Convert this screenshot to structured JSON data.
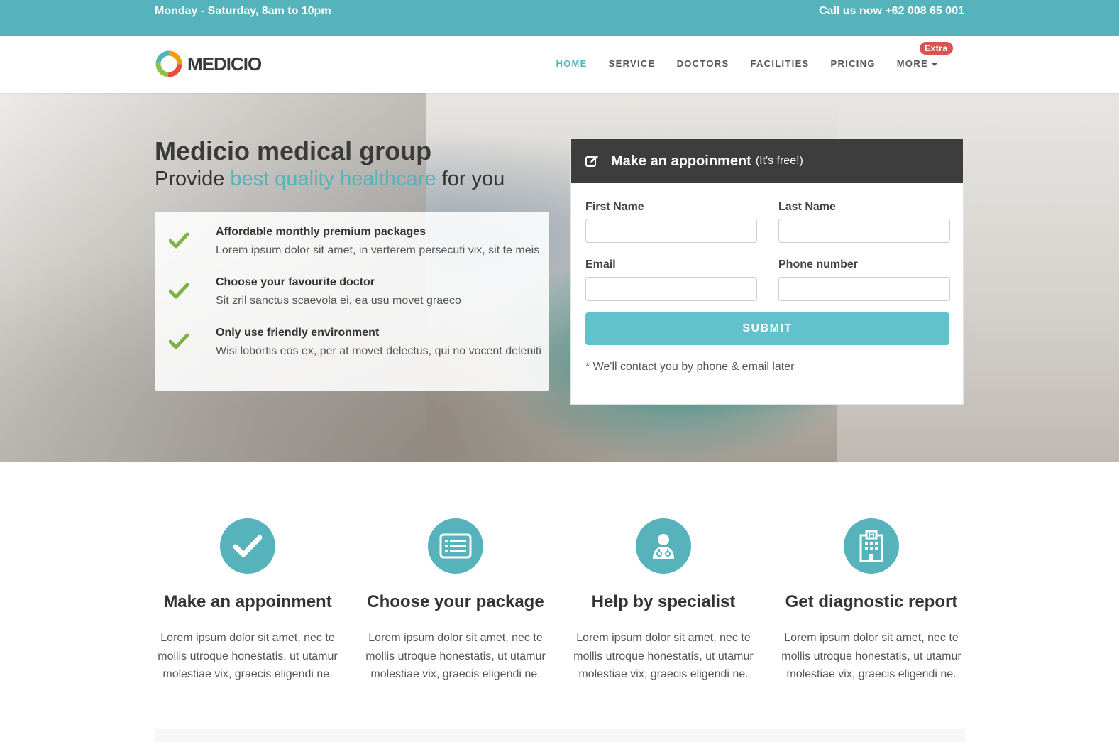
{
  "topbar": {
    "hours": "Monday - Saturday, 8am to 10pm",
    "call": "Call us now +62 008 65 001"
  },
  "brand": {
    "name": "MEDICIO"
  },
  "nav": {
    "items": [
      {
        "label": "HOME",
        "active": true
      },
      {
        "label": "SERVICE"
      },
      {
        "label": "DOCTORS"
      },
      {
        "label": "FACILITIES"
      },
      {
        "label": "PRICING"
      },
      {
        "label": "MORE"
      }
    ],
    "extra_badge": "Extra"
  },
  "hero": {
    "title": "Medicio medical group",
    "sub_prefix": "Provide ",
    "sub_highlight": "best quality healthcare",
    "sub_suffix": " for you",
    "features": [
      {
        "title": "Affordable monthly premium packages",
        "desc": "Lorem ipsum dolor sit amet, in verterem persecuti vix, sit te meis"
      },
      {
        "title": "Choose your favourite doctor",
        "desc": "Sit zril sanctus scaevola ei, ea usu movet graeco"
      },
      {
        "title": "Only use friendly environment",
        "desc": "Wisi lobortis eos ex, per at movet delectus, qui no vocent deleniti"
      }
    ]
  },
  "appointment": {
    "title": "Make an appoinment",
    "free": "(It's free!)",
    "first_name_label": "First Name",
    "last_name_label": "Last Name",
    "email_label": "Email",
    "phone_label": "Phone number",
    "first_name_value": "",
    "last_name_value": "",
    "email_value": "",
    "phone_value": "",
    "submit_label": "SUBMIT",
    "note": "* We'll contact you by phone & email later"
  },
  "services": [
    {
      "icon": "check-icon",
      "title": "Make an appoinment",
      "desc": "Lorem ipsum dolor sit amet, nec te mollis utroque honestatis, ut utamur molestiae vix, graecis eligendi ne."
    },
    {
      "icon": "list-alt-icon",
      "title": "Choose your package",
      "desc": "Lorem ipsum dolor sit amet, nec te mollis utroque honestatis, ut utamur molestiae vix, graecis eligendi ne."
    },
    {
      "icon": "user-md-icon",
      "title": "Help by specialist",
      "desc": "Lorem ipsum dolor sit amet, nec te mollis utroque honestatis, ut utamur molestiae vix, graecis eligendi ne."
    },
    {
      "icon": "hospital-icon",
      "title": "Get diagnostic report",
      "desc": "Lorem ipsum dolor sit amet, nec te mollis utroque honestatis, ut utamur molestiae vix, graecis eligendi ne."
    }
  ],
  "colors": {
    "accent": "#56b2bb",
    "button": "#61c2cb",
    "dark_header": "#3d3d3d",
    "check_green": "#7cb342",
    "badge_red": "#d9534f"
  }
}
